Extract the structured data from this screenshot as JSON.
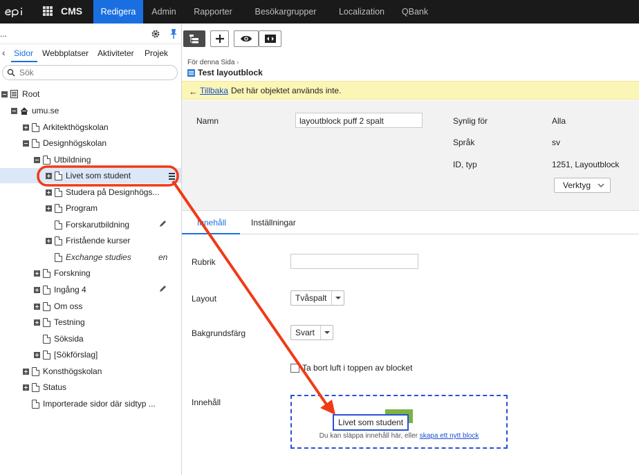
{
  "topbar": {
    "logo_text": "epi",
    "app_name": "CMS",
    "nav": [
      "Redigera",
      "Admin",
      "Rapporter",
      "Besökargrupper",
      "Localization",
      "QBank"
    ]
  },
  "left_panel": {
    "tabs": [
      "Sidor",
      "Webbplatser",
      "Aktiviteter",
      "Projek"
    ],
    "more_label": "...",
    "search_placeholder": "Sök",
    "tree": [
      {
        "label": "Root"
      },
      {
        "label": "umu.se"
      },
      {
        "label": "Arkitekthögskolan"
      },
      {
        "label": "Designhögskolan"
      },
      {
        "label": "Utbildning"
      },
      {
        "label": "Livet som student"
      },
      {
        "label": "Studera på Designhögs..."
      },
      {
        "label": "Program"
      },
      {
        "label": "Forskarutbildning"
      },
      {
        "label": "Fristående kurser"
      },
      {
        "label": "Exchange studies",
        "lang": "en"
      },
      {
        "label": "Forskning"
      },
      {
        "label": "Ingång 4"
      },
      {
        "label": "Om oss"
      },
      {
        "label": "Testning"
      },
      {
        "label": "Söksida"
      },
      {
        "label": "[Sökförslag]"
      },
      {
        "label": "Konsthögskolan"
      },
      {
        "label": "Status"
      },
      {
        "label": "Importerade sidor där sidtyp ..."
      }
    ]
  },
  "content": {
    "breadcrumb": "För denna Sida",
    "title": "Test layoutblock",
    "notice": {
      "link": "Tillbaka",
      "message": "Det här objektet används inte."
    },
    "meta": {
      "name_label": "Namn",
      "name_value": "layoutblock puff 2 spalt",
      "visible_label": "Synlig för",
      "visible_value": "Alla",
      "language_label": "Språk",
      "language_value": "sv",
      "id_label": "ID, typ",
      "id_value": "1251, Layoutblock",
      "tools_label": "Verktyg"
    },
    "tabs": [
      "Innehåll",
      "Inställningar"
    ],
    "fields": {
      "rubrik_label": "Rubrik",
      "rubrik_value": "",
      "layout_label": "Layout",
      "layout_value": "Tvåspalt",
      "bg_label": "Bakgrundsfärg",
      "bg_value": "Svart",
      "checkbox_label": "Ta bort luft i toppen av blocket",
      "content_label": "Innehåll",
      "drop_hint": "Du kan släppa innehåll här, eller",
      "drop_link": "skapa ett nytt block",
      "drag_tooltip": "Livet som student"
    }
  },
  "colors": {
    "accent": "#1a6fe0",
    "annotation": "#f03a17",
    "topbar": "#1a1a1a"
  }
}
